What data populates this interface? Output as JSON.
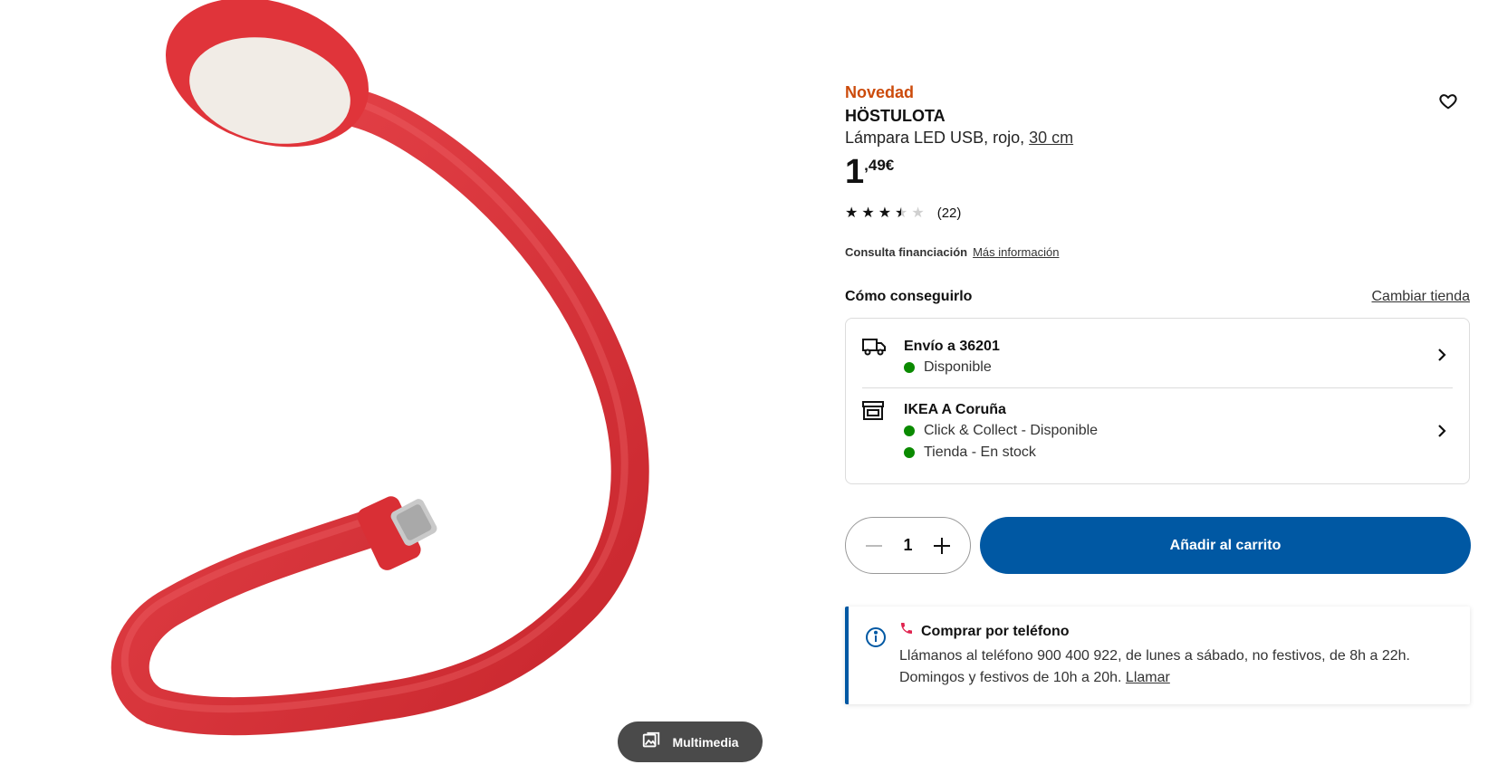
{
  "media": {
    "multimedia_label": "Multimedia",
    "image_icon": "image-gallery-icon"
  },
  "product": {
    "badge": "Novedad",
    "name": "HÖSTULOTA",
    "description": "Lámpara LED USB, rojo, ",
    "size_link": "30 cm",
    "price_int": "1",
    "price_dec": ",49€",
    "rating_stars": 3.5,
    "rating_count": "(22)",
    "favorite_icon": "heart-icon",
    "colors": {
      "badge": "#cc4b0b",
      "product_red": "#e0343a"
    }
  },
  "financing": {
    "label": "Consulta financiación",
    "link": "Más información"
  },
  "availability": {
    "title": "Cómo conseguirlo",
    "change_store": "Cambiar tienda",
    "delivery": {
      "icon": "truck-icon",
      "title": "Envío a 36201",
      "status": "Disponible"
    },
    "store": {
      "icon": "store-icon",
      "title": "IKEA A Coruña",
      "status_1": "Click & Collect - Disponible",
      "status_2": "Tienda - En stock"
    },
    "status_color": "#0a8a00"
  },
  "cart": {
    "quantity": "1",
    "add_label": "Añadir al carrito",
    "button_color": "#0058a3"
  },
  "phone": {
    "title": "Comprar por teléfono",
    "text": "Llámanos al teléfono 900 400 922, de lunes a sábado, no festivos, de 8h a 22h. Domingos y festivos de 10h a 20h. ",
    "link": "Llamar",
    "icon": "phone-icon",
    "info_icon": "info-icon"
  }
}
